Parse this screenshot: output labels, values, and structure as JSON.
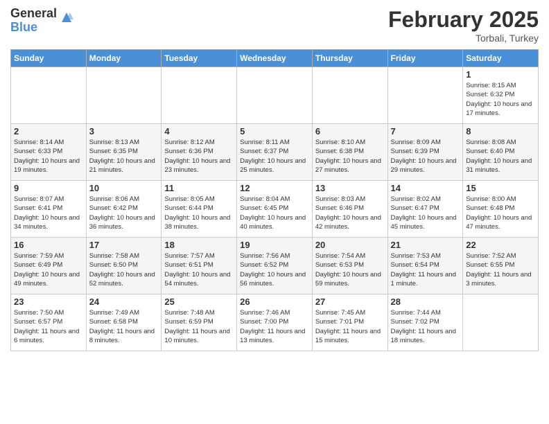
{
  "logo": {
    "general": "General",
    "blue": "Blue"
  },
  "title": "February 2025",
  "subtitle": "Torbali, Turkey",
  "days_header": [
    "Sunday",
    "Monday",
    "Tuesday",
    "Wednesday",
    "Thursday",
    "Friday",
    "Saturday"
  ],
  "weeks": [
    [
      {
        "day": "",
        "info": ""
      },
      {
        "day": "",
        "info": ""
      },
      {
        "day": "",
        "info": ""
      },
      {
        "day": "",
        "info": ""
      },
      {
        "day": "",
        "info": ""
      },
      {
        "day": "",
        "info": ""
      },
      {
        "day": "1",
        "info": "Sunrise: 8:15 AM\nSunset: 6:32 PM\nDaylight: 10 hours and 17 minutes."
      }
    ],
    [
      {
        "day": "2",
        "info": "Sunrise: 8:14 AM\nSunset: 6:33 PM\nDaylight: 10 hours and 19 minutes."
      },
      {
        "day": "3",
        "info": "Sunrise: 8:13 AM\nSunset: 6:35 PM\nDaylight: 10 hours and 21 minutes."
      },
      {
        "day": "4",
        "info": "Sunrise: 8:12 AM\nSunset: 6:36 PM\nDaylight: 10 hours and 23 minutes."
      },
      {
        "day": "5",
        "info": "Sunrise: 8:11 AM\nSunset: 6:37 PM\nDaylight: 10 hours and 25 minutes."
      },
      {
        "day": "6",
        "info": "Sunrise: 8:10 AM\nSunset: 6:38 PM\nDaylight: 10 hours and 27 minutes."
      },
      {
        "day": "7",
        "info": "Sunrise: 8:09 AM\nSunset: 6:39 PM\nDaylight: 10 hours and 29 minutes."
      },
      {
        "day": "8",
        "info": "Sunrise: 8:08 AM\nSunset: 6:40 PM\nDaylight: 10 hours and 31 minutes."
      }
    ],
    [
      {
        "day": "9",
        "info": "Sunrise: 8:07 AM\nSunset: 6:41 PM\nDaylight: 10 hours and 34 minutes."
      },
      {
        "day": "10",
        "info": "Sunrise: 8:06 AM\nSunset: 6:42 PM\nDaylight: 10 hours and 36 minutes."
      },
      {
        "day": "11",
        "info": "Sunrise: 8:05 AM\nSunset: 6:44 PM\nDaylight: 10 hours and 38 minutes."
      },
      {
        "day": "12",
        "info": "Sunrise: 8:04 AM\nSunset: 6:45 PM\nDaylight: 10 hours and 40 minutes."
      },
      {
        "day": "13",
        "info": "Sunrise: 8:03 AM\nSunset: 6:46 PM\nDaylight: 10 hours and 42 minutes."
      },
      {
        "day": "14",
        "info": "Sunrise: 8:02 AM\nSunset: 6:47 PM\nDaylight: 10 hours and 45 minutes."
      },
      {
        "day": "15",
        "info": "Sunrise: 8:00 AM\nSunset: 6:48 PM\nDaylight: 10 hours and 47 minutes."
      }
    ],
    [
      {
        "day": "16",
        "info": "Sunrise: 7:59 AM\nSunset: 6:49 PM\nDaylight: 10 hours and 49 minutes."
      },
      {
        "day": "17",
        "info": "Sunrise: 7:58 AM\nSunset: 6:50 PM\nDaylight: 10 hours and 52 minutes."
      },
      {
        "day": "18",
        "info": "Sunrise: 7:57 AM\nSunset: 6:51 PM\nDaylight: 10 hours and 54 minutes."
      },
      {
        "day": "19",
        "info": "Sunrise: 7:56 AM\nSunset: 6:52 PM\nDaylight: 10 hours and 56 minutes."
      },
      {
        "day": "20",
        "info": "Sunrise: 7:54 AM\nSunset: 6:53 PM\nDaylight: 10 hours and 59 minutes."
      },
      {
        "day": "21",
        "info": "Sunrise: 7:53 AM\nSunset: 6:54 PM\nDaylight: 11 hours and 1 minute."
      },
      {
        "day": "22",
        "info": "Sunrise: 7:52 AM\nSunset: 6:55 PM\nDaylight: 11 hours and 3 minutes."
      }
    ],
    [
      {
        "day": "23",
        "info": "Sunrise: 7:50 AM\nSunset: 6:57 PM\nDaylight: 11 hours and 6 minutes."
      },
      {
        "day": "24",
        "info": "Sunrise: 7:49 AM\nSunset: 6:58 PM\nDaylight: 11 hours and 8 minutes."
      },
      {
        "day": "25",
        "info": "Sunrise: 7:48 AM\nSunset: 6:59 PM\nDaylight: 11 hours and 10 minutes."
      },
      {
        "day": "26",
        "info": "Sunrise: 7:46 AM\nSunset: 7:00 PM\nDaylight: 11 hours and 13 minutes."
      },
      {
        "day": "27",
        "info": "Sunrise: 7:45 AM\nSunset: 7:01 PM\nDaylight: 11 hours and 15 minutes."
      },
      {
        "day": "28",
        "info": "Sunrise: 7:44 AM\nSunset: 7:02 PM\nDaylight: 11 hours and 18 minutes."
      },
      {
        "day": "",
        "info": ""
      }
    ]
  ]
}
